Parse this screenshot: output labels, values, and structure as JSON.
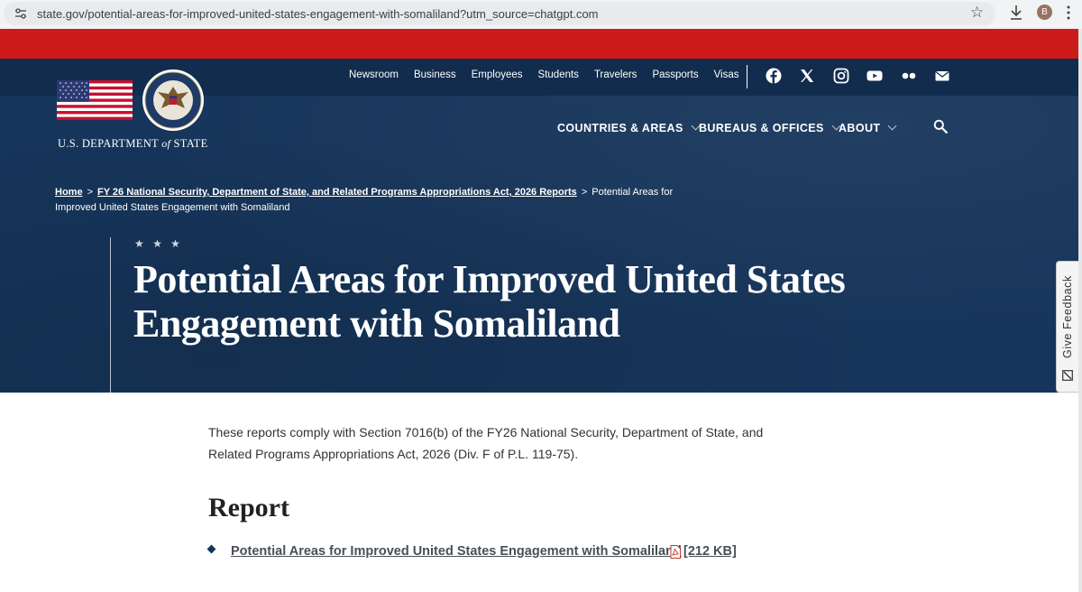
{
  "browser": {
    "url": "state.gov/potential-areas-for-improved-united-states-engagement-with-somaliland?utm_source=chatgpt.com",
    "profile_initial": "B"
  },
  "header": {
    "department_name_pre": "U.S. DEPARTMENT ",
    "department_name_of": "of",
    "department_name_post": " STATE",
    "top_links": [
      "Newsroom",
      "Business",
      "Employees",
      "Students",
      "Travelers",
      "Passports",
      "Visas"
    ],
    "social_icons": [
      "facebook-icon",
      "x-icon",
      "instagram-icon",
      "youtube-icon",
      "flickr-icon",
      "email-icon"
    ],
    "main_nav": [
      "COUNTRIES & AREAS",
      "BUREAUS & OFFICES",
      "ABOUT"
    ]
  },
  "breadcrumb": {
    "home": "Home",
    "sep1": ">",
    "parent": "FY 26 National Security, Department of State, and Related Programs Appropriations Act, 2026 Reports",
    "sep2": ">",
    "current": "Potential Areas for Improved United States Engagement with Somaliland"
  },
  "hero": {
    "stars": "★ ★ ★",
    "title": "Potential Areas for Improved United States Engagement with Somaliland"
  },
  "content": {
    "intro": "These reports comply with Section 7016(b) of the FY26 National Security, Department of State, and Related Programs Appropriations Act, 2026 (Div. F of P.L. 119-75).",
    "section_title": "Report",
    "report_link": "Potential Areas for Improved United States Engagement with Somaliland",
    "file_size": "[212 KB]"
  },
  "feedback": {
    "label": "Give Feedback"
  },
  "colors": {
    "navy": "#16355a",
    "red": "#cd1a1a"
  }
}
